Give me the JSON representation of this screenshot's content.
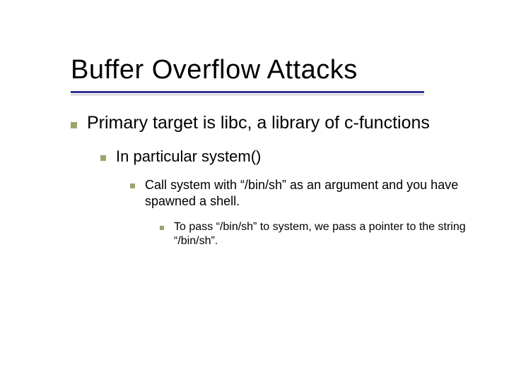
{
  "title": "Buffer Overflow Attacks",
  "bullets": {
    "l1": "Primary target is libc, a library of c-functions",
    "l2": "In particular system()",
    "l3": "Call system with “/bin/sh” as an argument and you have spawned a shell.",
    "l4": "To pass “/bin/sh” to system, we pass a pointer to the string “/bin/sh”."
  }
}
